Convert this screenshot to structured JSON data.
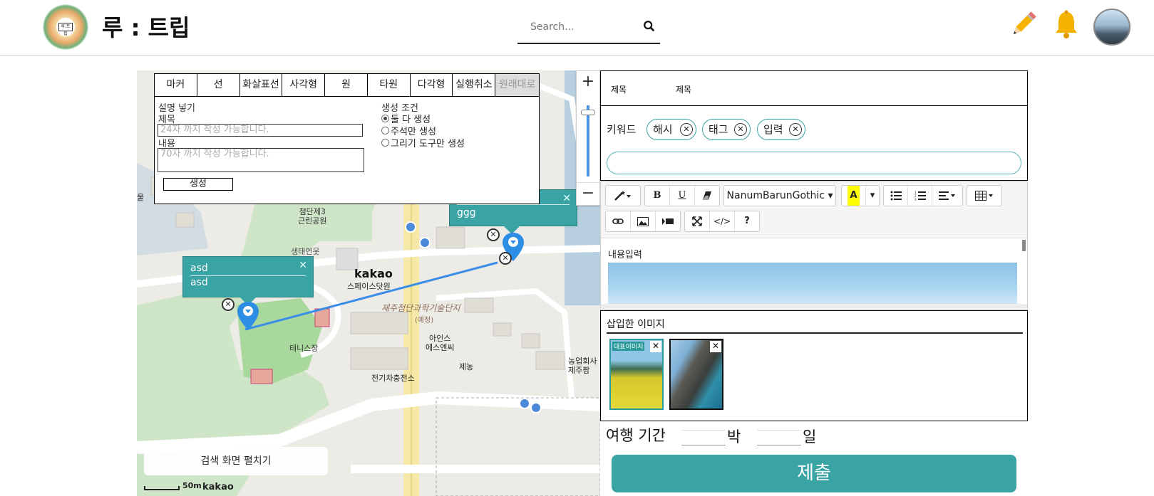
{
  "header": {
    "logo_text": "루:트립",
    "brand": "루 : 트립",
    "search_placeholder": "Search..."
  },
  "toolbar_tabs": [
    "마커",
    "선",
    "화살표선",
    "사각형",
    "원",
    "타원",
    "다각형",
    "실행취소",
    "원래대로"
  ],
  "tool_panel": {
    "heading": "설명 넣기",
    "title_label": "제목",
    "title_placeholder": "24자 까지 작성 가능합니다.",
    "content_label": "내용",
    "content_placeholder": "70자 까지 작성 가능합니다.",
    "create_button": "생성",
    "condition_label": "생성 조건",
    "options": [
      "둘 다 생성",
      "주석만 생성",
      "그리기 도구만 생성"
    ],
    "selected_option": 0
  },
  "map": {
    "zoom_plus": "+",
    "zoom_minus": "−",
    "info_boxes": [
      {
        "line1": "asd",
        "line2": "asd"
      },
      {
        "line1": "ggg",
        "line2": "ggg"
      }
    ],
    "labels": {
      "park": "첨단제3\n근린공원",
      "eco": "생태연못",
      "kakao": "kakao",
      "kakao_sub": "스페이스닷원",
      "complex": "제주첨단과학기술단지",
      "planned": "(예정)",
      "tennis": "테니스장",
      "ains": "아인스\n에스엔씨",
      "jenong": "제농",
      "ev": "전기차충전소",
      "farm": "농업회사\n제주팜",
      "park_left": "울"
    },
    "expand_button": "검색 화면 펼치기",
    "scale": "50m",
    "provider": "kakao"
  },
  "form": {
    "title_label": "제목",
    "title_value": "제목",
    "keyword_label": "키워드",
    "tags": [
      "해시",
      "태그",
      "입력"
    ],
    "editor": {
      "font": "NanumBarunGothic",
      "placeholder": "내용입력"
    },
    "images_title": "삽입한 이미지",
    "rep_badge": "대표이미지",
    "period_label": "여행 기간",
    "nights_unit": "박",
    "days_unit": "일",
    "submit": "제출"
  },
  "colors": {
    "accent": "#3aa3a3",
    "route": "#3b8ee8"
  },
  "icons": [
    "search-icon",
    "pencil-icon",
    "bell-icon",
    "map-pin-icon",
    "close-icon",
    "magic-wand-icon",
    "bold-icon",
    "underline-icon",
    "eraser-icon",
    "text-color-icon",
    "bullet-list-icon",
    "ordered-list-icon",
    "align-icon",
    "table-icon",
    "link-icon",
    "image-icon",
    "video-icon",
    "fullscreen-icon",
    "code-icon",
    "help-icon"
  ]
}
